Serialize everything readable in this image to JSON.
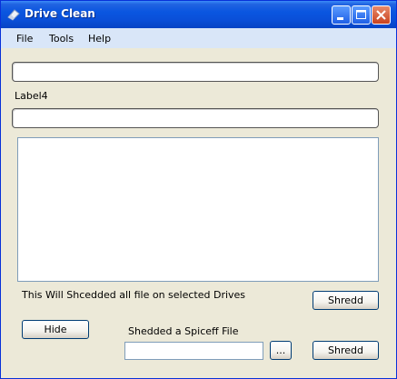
{
  "window": {
    "title": "Drive Clean",
    "title_icon": "eraser-icon"
  },
  "titlebar_buttons": {
    "minimize": "minimize-icon",
    "maximize": "maximize-icon",
    "close": "close-icon"
  },
  "menu": {
    "items": [
      "File",
      "Tools",
      "Help"
    ]
  },
  "form": {
    "input1_value": "",
    "label4": "Label4",
    "input2_value": "",
    "list_content": "",
    "shred_drives_text": "This Will Shcedded all file on selected Drives",
    "shredd_button_1": "Shredd",
    "hide_button": "Hide",
    "file_section_label": "Shedded a Spiceff File",
    "file_path_value": "",
    "browse_button": "...",
    "shredd_button_2": "Shredd"
  }
}
